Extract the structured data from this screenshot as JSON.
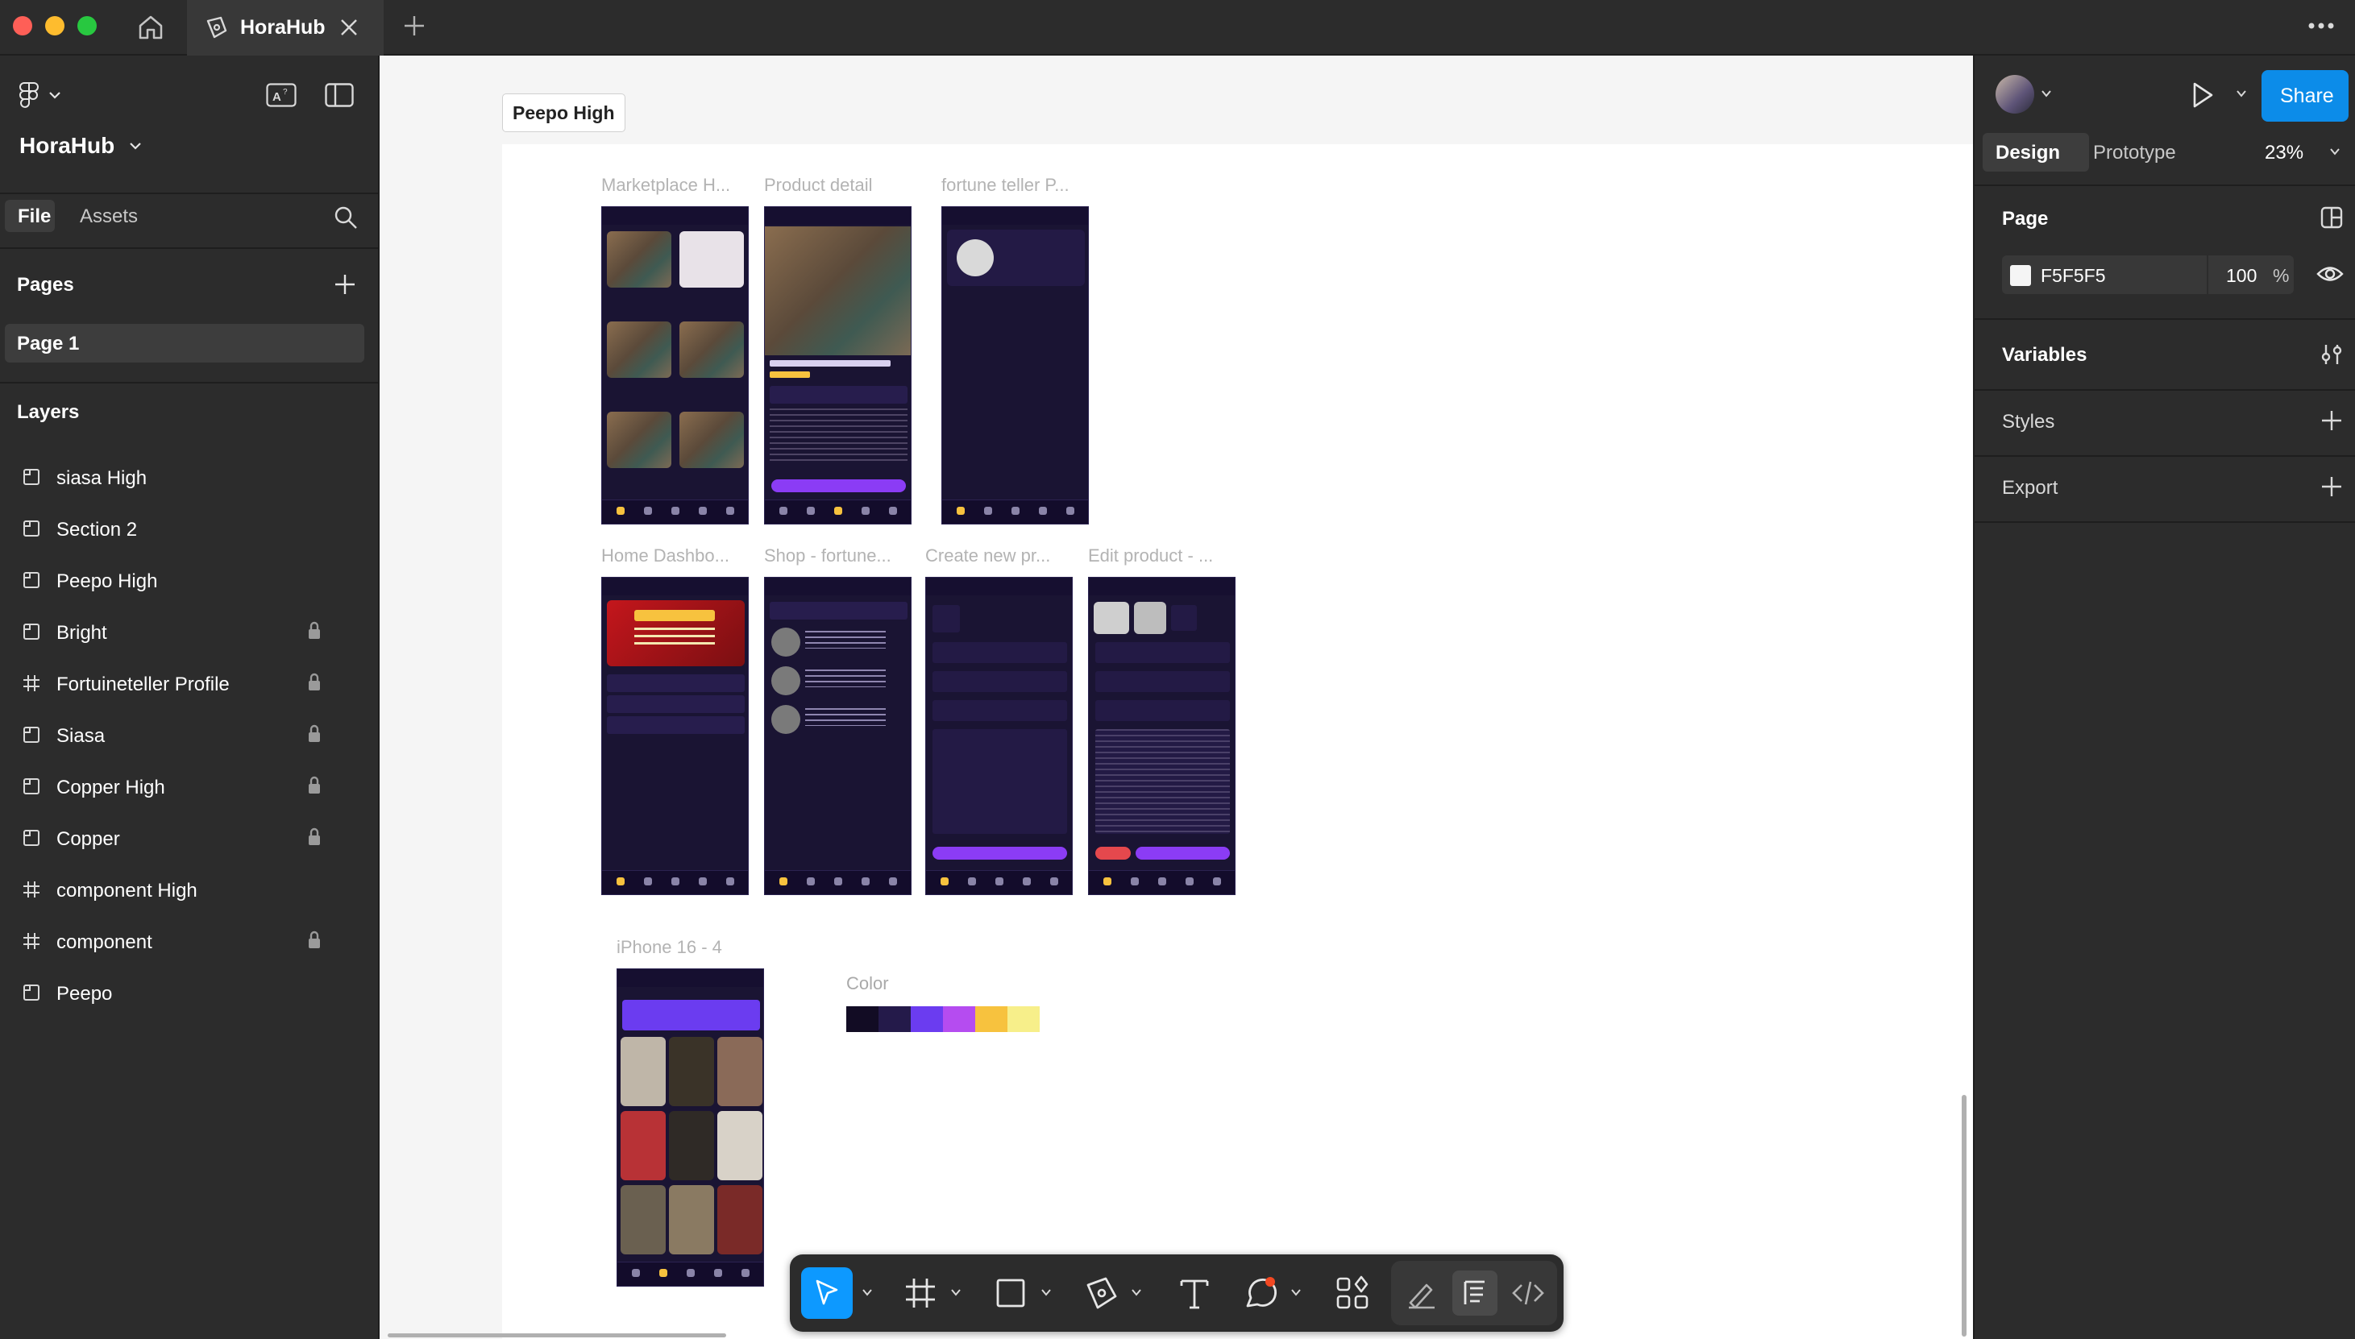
{
  "window": {
    "tab_title": "HoraHub"
  },
  "left_panel": {
    "file_name": "HoraHub",
    "tabs": [
      "File",
      "Assets"
    ],
    "pages_heading": "Pages",
    "pages": [
      "Page 1"
    ],
    "layers_heading": "Layers",
    "layers": [
      {
        "name": "siasa High",
        "type": "section",
        "locked": false
      },
      {
        "name": "Section 2",
        "type": "section",
        "locked": false
      },
      {
        "name": "Peepo High",
        "type": "section",
        "locked": false
      },
      {
        "name": "Bright",
        "type": "section",
        "locked": true
      },
      {
        "name": "Fortuineteller Profile",
        "type": "frame",
        "locked": true
      },
      {
        "name": "Siasa",
        "type": "section",
        "locked": true
      },
      {
        "name": "Copper High",
        "type": "section",
        "locked": true
      },
      {
        "name": "Copper",
        "type": "section",
        "locked": true
      },
      {
        "name": "component  High",
        "type": "frame",
        "locked": false
      },
      {
        "name": "component",
        "type": "frame",
        "locked": true
      },
      {
        "name": "Peepo",
        "type": "section",
        "locked": false
      }
    ]
  },
  "canvas": {
    "section_label": "Peepo High",
    "frames": [
      {
        "title": "Marketplace H..."
      },
      {
        "title": "Product detail"
      },
      {
        "title": "fortune teller P..."
      },
      {
        "title": "Home Dashbo..."
      },
      {
        "title": "Shop - fortune..."
      },
      {
        "title": "Create new pr..."
      },
      {
        "title": "Edit product - ..."
      },
      {
        "title": "iPhone 16 - 4"
      }
    ],
    "color_label": "Color",
    "palette": [
      "#120c24",
      "#241a4a",
      "#6b3cf0",
      "#b54cf0",
      "#f7c23e",
      "#f7ef8a"
    ]
  },
  "right_panel": {
    "tabs": [
      "Design",
      "Prototype"
    ],
    "zoom": "23%",
    "share_label": "Share",
    "page_heading": "Page",
    "page_color": "F5F5F5",
    "page_opacity": "100",
    "percent": "%",
    "sections": [
      "Variables",
      "Styles",
      "Export"
    ]
  },
  "colors": {
    "accent": "#0d99ff",
    "share": "#0c8ce9",
    "panel": "#2c2c2c",
    "canvas": "#f5f5f5"
  },
  "help": "?"
}
